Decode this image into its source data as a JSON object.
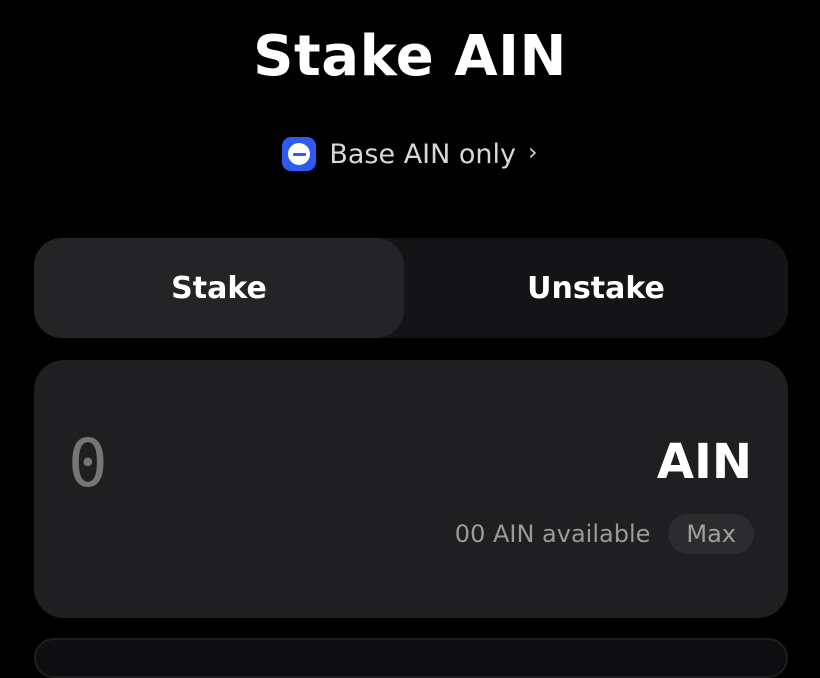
{
  "header": {
    "title": "Stake AIN"
  },
  "network": {
    "label": "Base AIN only",
    "chevron": "›",
    "icon": "base-network-icon",
    "icon_color": "#2f5af0"
  },
  "tabs": [
    {
      "label": "Stake",
      "active": true
    },
    {
      "label": "Unstake",
      "active": false
    }
  ],
  "stake_card": {
    "amount_placeholder": "0",
    "token": "AIN",
    "available_text": "00 AIN available",
    "max_label": "Max"
  },
  "colors": {
    "background": "#000000",
    "card": "#1f1f21",
    "tab_active": "#242426",
    "tab_bar": "#141416",
    "accent": "#2f5af0"
  }
}
